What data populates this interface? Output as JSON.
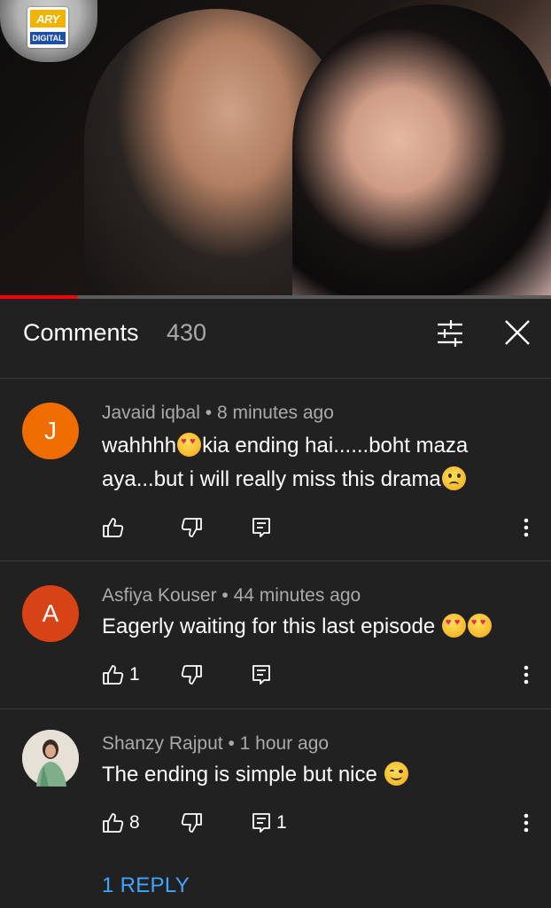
{
  "video": {
    "channel_logo_top": "ARY",
    "channel_logo_bottom": "DIGITAL",
    "progress_percent": 14
  },
  "comments_panel": {
    "title": "Comments",
    "count": "430",
    "filter_icon": "sort-filter-icon",
    "close_icon": "close-icon"
  },
  "comments": [
    {
      "avatar_letter": "J",
      "avatar_color": "#ef6c00",
      "author": "Javaid iqbal",
      "time": "8 minutes ago",
      "text_parts": [
        "wahhhh",
        "kia ending hai......boht maza aya...but i will really miss this drama"
      ],
      "likes": "",
      "replies": ""
    },
    {
      "avatar_letter": "A",
      "avatar_color": "#d84315",
      "author": "Asfiya Kouser",
      "time": "44 minutes ago",
      "text_parts": [
        "Eagerly waiting for this last episode "
      ],
      "likes": "1",
      "replies": ""
    },
    {
      "avatar_letter": "",
      "avatar_color": "#d9d2c8",
      "author": "Shanzy Rajput",
      "time": "1 hour ago",
      "text_parts": [
        "The ending is simple but nice "
      ],
      "likes": "8",
      "replies": "1"
    }
  ],
  "view_replies_label": "1 REPLY",
  "dot_separator": "•"
}
